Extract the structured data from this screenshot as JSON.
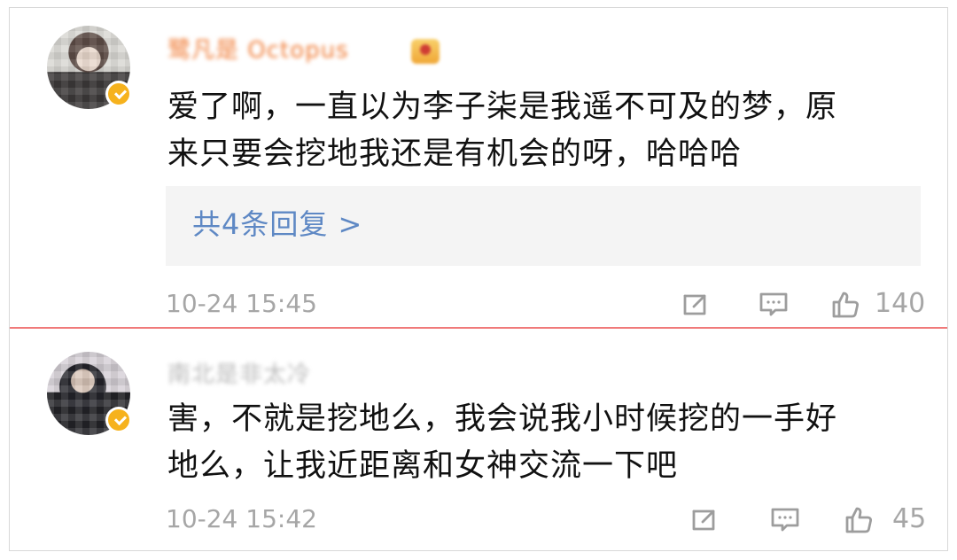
{
  "comments": [
    {
      "username": "鹭凡是 Octopus",
      "text": "爱了啊，一直以为李子柒是我遥不可及的梦，原\n来只要会挖地我还是有机会的呀，哈哈哈",
      "replies_label": "共4条回复 >",
      "time": "10-24 15:45",
      "likes": "140",
      "icons": {
        "share": "share-icon",
        "comment": "comment-icon",
        "like": "like-icon"
      }
    },
    {
      "username": "南北是非太冷",
      "text": "害，不就是挖地么，我会说我小时候挖的一手好\n地么，让我近距离和女神交流一下吧",
      "time": "10-24 15:42",
      "likes": "45",
      "icons": {
        "share": "share-icon",
        "comment": "comment-icon",
        "like": "like-icon"
      }
    }
  ],
  "colors": {
    "accent_blue": "#5e88c4",
    "divider_red": "#f07a7a",
    "verified_yellow": "#f6b21d",
    "muted_gray": "#a6a6a6"
  }
}
